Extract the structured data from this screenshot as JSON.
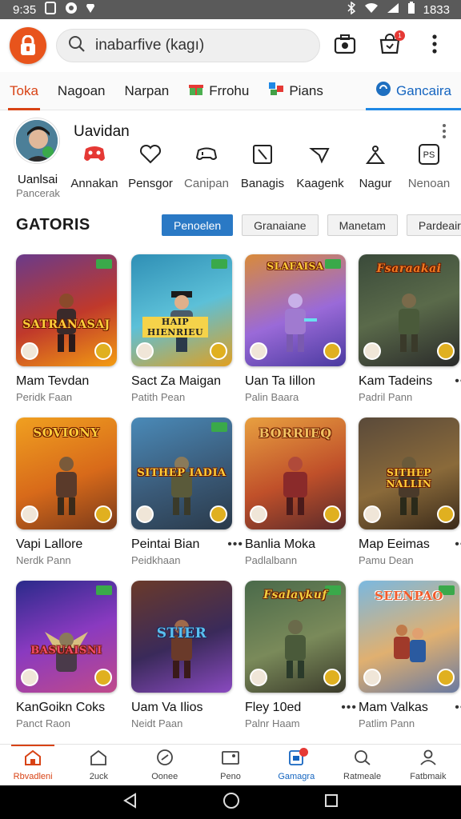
{
  "status_bar": {
    "time": "9:35",
    "battery": "1833"
  },
  "search": {
    "placeholder": "inabarfive (kagı)"
  },
  "notifications": {
    "cart_badge": "1"
  },
  "tabs": [
    {
      "label": "Toka"
    },
    {
      "label": "Nagoan"
    },
    {
      "label": "Narpan"
    },
    {
      "label": "Frrohu"
    },
    {
      "label": "Pians"
    },
    {
      "label": "Gancaira"
    }
  ],
  "profile": {
    "name": "Uavidan",
    "label": "Uanlsai",
    "sub": "Pancerak"
  },
  "categories": [
    {
      "label": "Annakan",
      "icon": "gamepad-icon"
    },
    {
      "label": "Pensgor",
      "icon": "heart-icon"
    },
    {
      "label": "Canipan",
      "icon": "controller-icon"
    },
    {
      "label": "Banagis",
      "icon": "sword-icon"
    },
    {
      "label": "Kaagenk",
      "icon": "arrow-icon"
    },
    {
      "label": "Nagur",
      "icon": "person-icon"
    },
    {
      "label": "Nenoan",
      "icon": "ps-icon"
    }
  ],
  "section": {
    "title": "GATORIS"
  },
  "chips": [
    {
      "label": "Penoelen"
    },
    {
      "label": "Granaiane"
    },
    {
      "label": "Manetam"
    },
    {
      "label": "Pardeairy"
    }
  ],
  "games": [
    {
      "title": "SATRANASAJ",
      "name": "Mam Tevdan",
      "sub": "Peridk Faan"
    },
    {
      "title": "HAIP HIENRIEU",
      "name": "Sact Za Maigan",
      "sub": "Patith Pean"
    },
    {
      "title": "SLAFAISA",
      "name": "Uan Ta Iillon",
      "sub": "Palin Baara"
    },
    {
      "title": "Fsaraakai",
      "name": "Kam Tadeins",
      "sub": "Padril Pann"
    },
    {
      "title": "SOVIONY",
      "name": "Vapi Lallore",
      "sub": "Nerdk Pann"
    },
    {
      "title": "SITHEP IADIA",
      "name": "Peintai Bian",
      "sub": "Peidkhaan"
    },
    {
      "title": "BORRIEQ",
      "name": "Banlia Moka",
      "sub": "Padlalbann"
    },
    {
      "title": "SITHEP NALLIN",
      "name": "Map Eeimas",
      "sub": "Pamu Dean"
    },
    {
      "title": "BASUAISNI",
      "name": "KanGoikn Coks",
      "sub": "Panct Raon"
    },
    {
      "title": "STIER",
      "name": "Uam Va Ilios",
      "sub": "Neidt Paan"
    },
    {
      "title": "Fsalaykuf",
      "name": "Fley 10ed",
      "sub": "Palnr Haam"
    },
    {
      "title": "SEENPAO",
      "name": "Mam Valkas",
      "sub": "Patlim Pann"
    }
  ],
  "bottom_nav": [
    {
      "label": "Rbvadleni"
    },
    {
      "label": "2uck"
    },
    {
      "label": "Oonee"
    },
    {
      "label": "Peno"
    },
    {
      "label": "Gamagra"
    },
    {
      "label": "Ratmeale"
    },
    {
      "label": "Fatbmaik"
    }
  ],
  "colors": {
    "accent": "#e8541c",
    "primary_blue": "#2a79c5",
    "status_bar": "#5a5a5a"
  }
}
